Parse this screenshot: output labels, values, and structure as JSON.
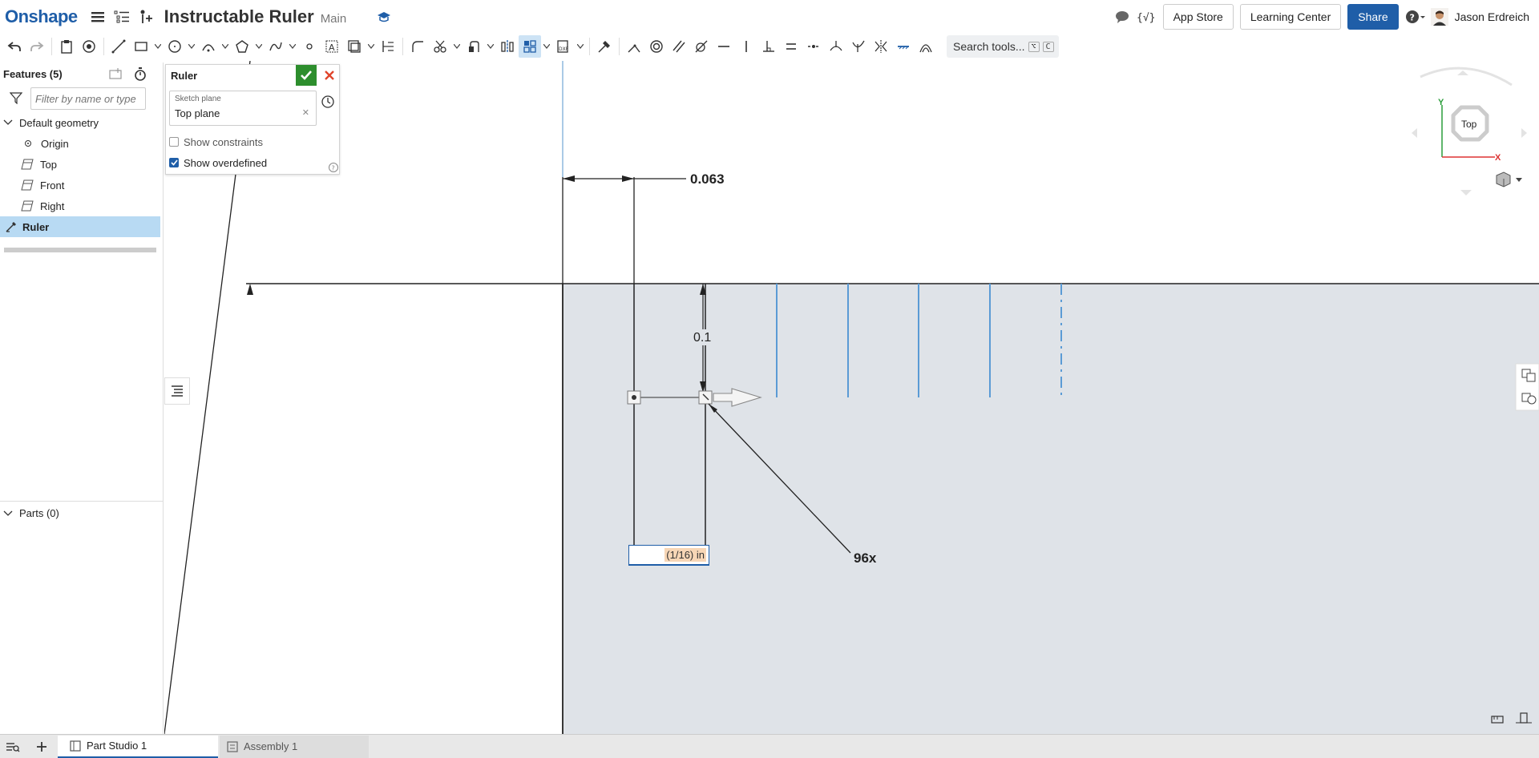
{
  "header": {
    "logo": "Onshape",
    "doc_title": "Instructable Ruler",
    "branch": "Main",
    "app_store": "App Store",
    "learning_center": "Learning Center",
    "share": "Share",
    "user_name": "Jason Erdreich"
  },
  "toolbar": {
    "search_label": "Search tools...",
    "search_shortcut_1": "⌥",
    "search_shortcut_2": "C"
  },
  "features": {
    "header": "Features (5)",
    "filter_placeholder": "Filter by name or type",
    "items": [
      {
        "label": "Default geometry"
      },
      {
        "label": "Origin"
      },
      {
        "label": "Top"
      },
      {
        "label": "Front"
      },
      {
        "label": "Right"
      },
      {
        "label": "Ruler"
      }
    ],
    "parts_header": "Parts (0)"
  },
  "dialog": {
    "title": "Ruler",
    "sketch_plane_label": "Sketch plane",
    "sketch_plane_value": "Top plane",
    "show_constraints": "Show constraints",
    "show_overdefined": "Show overdefined",
    "show_constraints_checked": false,
    "show_overdefined_checked": true
  },
  "canvas": {
    "dim_horizontal": "0.063",
    "dim_vertical": "0.1",
    "pattern_count": "96x",
    "input_value": "(1/16) in",
    "view_cube_label": "Top",
    "axis_y": "Y",
    "axis_x": "X"
  },
  "tabs": [
    {
      "label": "Part Studio 1"
    },
    {
      "label": "Assembly 1"
    }
  ],
  "colors": {
    "brand": "#1f5ea8",
    "accent_green": "#2d8e2d",
    "selection": "#b8daf3",
    "sketch_blue": "#5b9bd5"
  }
}
